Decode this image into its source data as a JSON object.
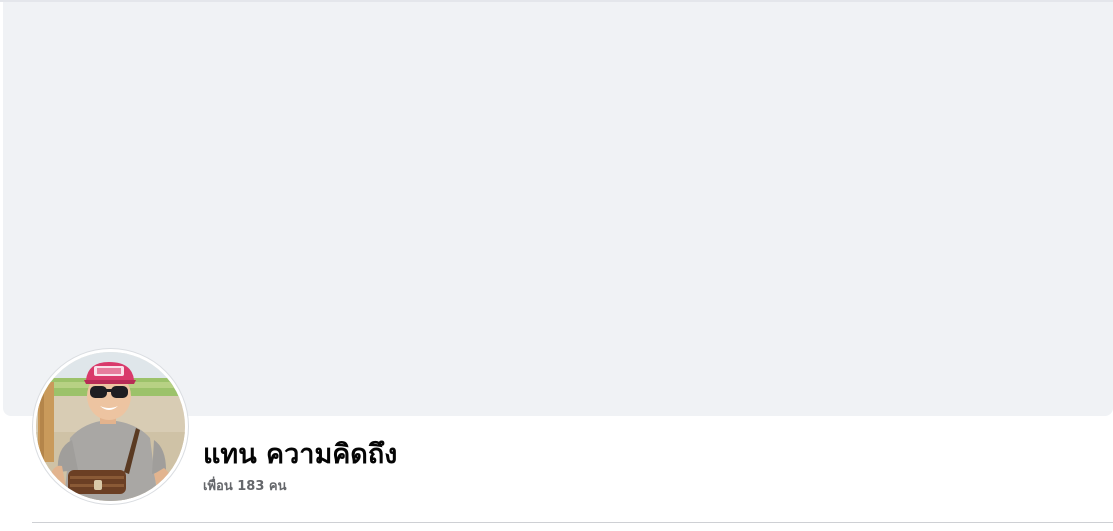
{
  "profile": {
    "name": "แทน ความคิดถึง",
    "friends_label": "เพื่อน 183 คน",
    "avatar_alt": "แทน ความคิดถึง"
  },
  "colors": {
    "cover_background": "#f0f2f5",
    "name_text": "#050505",
    "secondary_text": "#65676b",
    "divider": "#ced0d4"
  }
}
